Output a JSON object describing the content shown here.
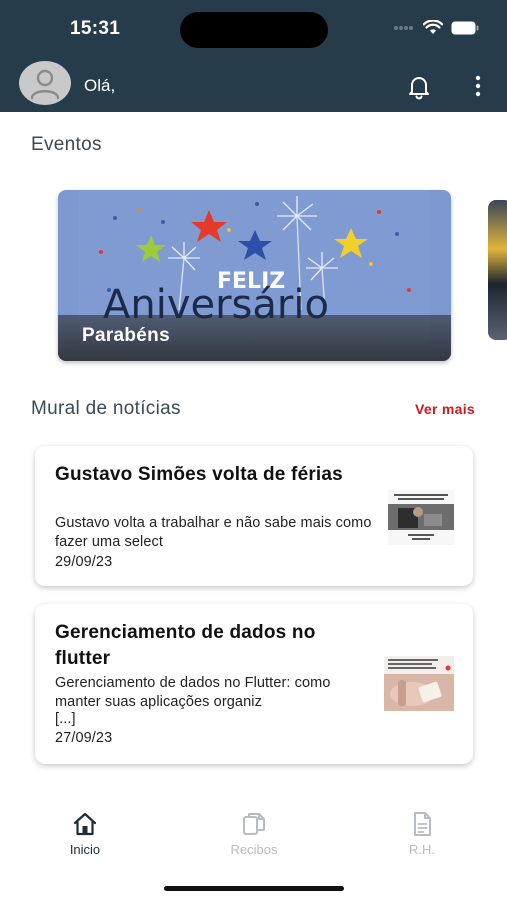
{
  "status_bar": {
    "time": "15:31"
  },
  "header": {
    "greeting": "Olá,"
  },
  "events": {
    "title": "Eventos",
    "cards": [
      {
        "label": "Parabéns",
        "art_line1": "FELIZ",
        "art_line2": "Aniversário"
      }
    ]
  },
  "news": {
    "title": "Mural de notícias",
    "see_more": "Ver mais",
    "items": [
      {
        "title": "Gustavo Simões volta de férias",
        "description": "Gustavo volta a trabalhar e não sabe mais como fazer uma select",
        "date": "29/09/23"
      },
      {
        "title": "Gerenciamento de dados no flutter",
        "description": "Gerenciamento de dados no Flutter: como manter suas aplicações organiz",
        "ellipsis": "[...]",
        "date": "27/09/23"
      }
    ]
  },
  "bottom_nav": {
    "items": [
      {
        "label": "Inicio",
        "icon": "home-icon",
        "active": true
      },
      {
        "label": "Recibos",
        "icon": "receipts-icon",
        "active": false
      },
      {
        "label": "R.H.",
        "icon": "document-icon",
        "active": false
      }
    ]
  },
  "colors": {
    "header_bg": "#273c4a",
    "accent_red": "#d3151d",
    "nav_active": "#1d2e3a",
    "nav_inactive": "#b6bcc2"
  }
}
